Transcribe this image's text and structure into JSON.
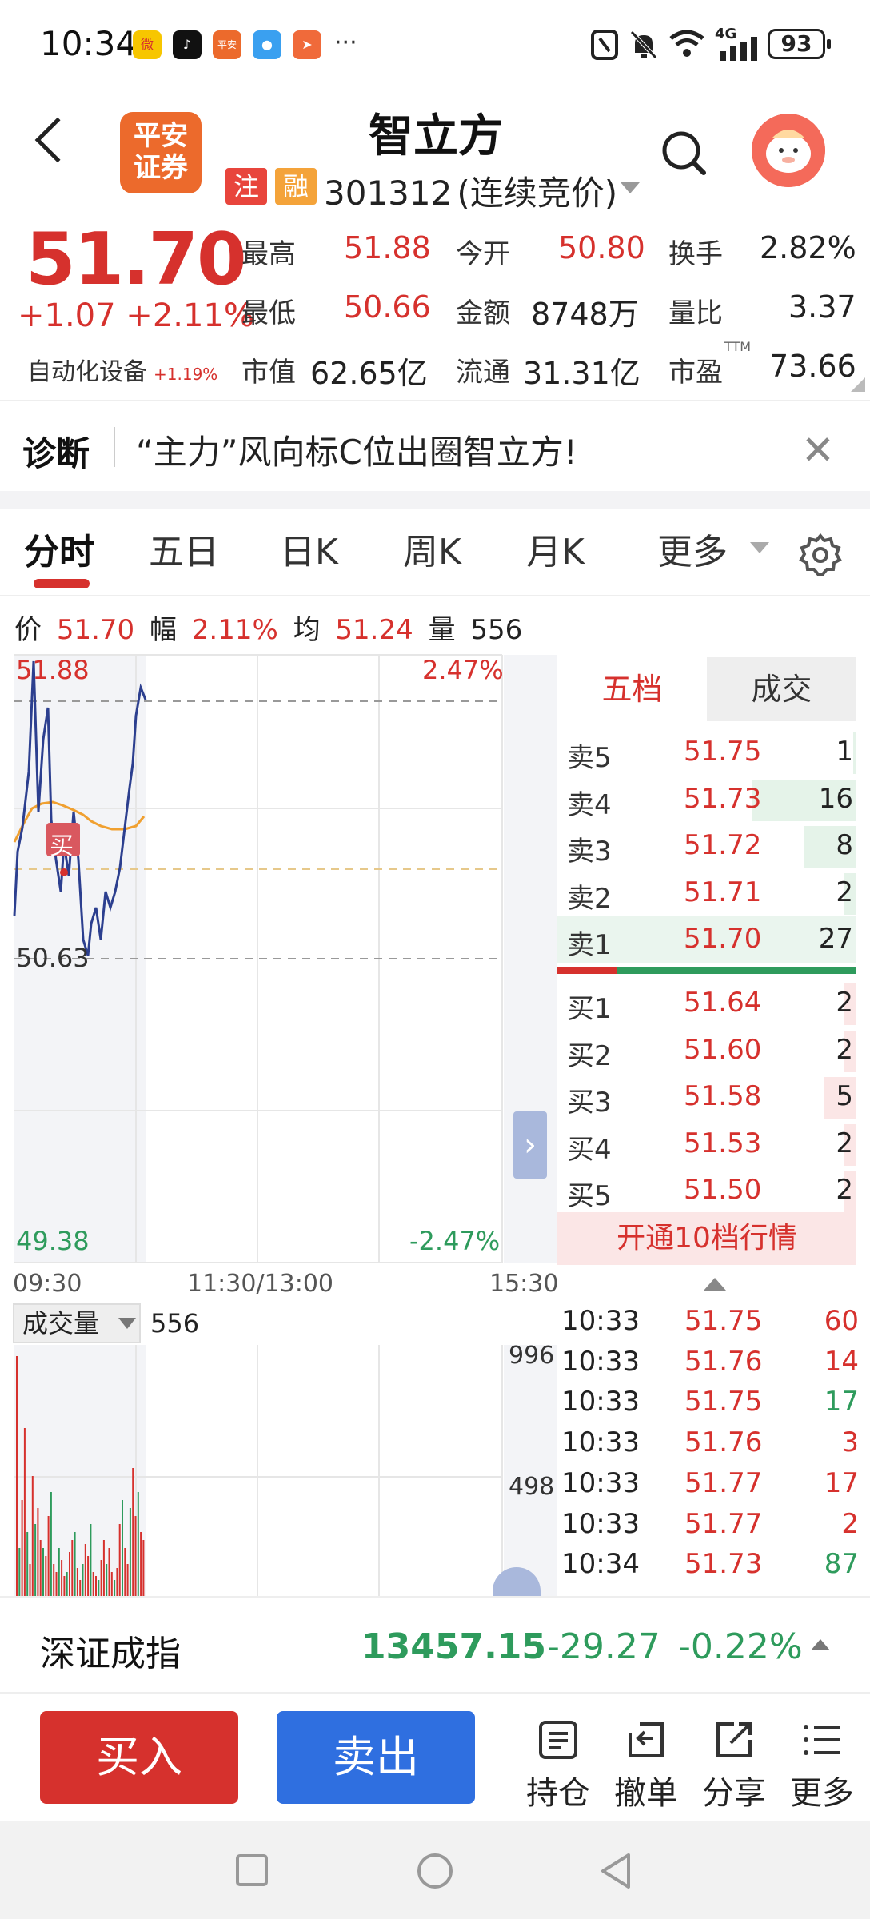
{
  "status_bar": {
    "time": "10:34",
    "battery": "93",
    "network": "4G",
    "icons": [
      "weibo-icon",
      "tiktok-icon",
      "pingan-app-icon",
      "message-icon",
      "send-icon",
      "nfc-icon",
      "mute-icon",
      "wifi-icon",
      "signal-icon"
    ]
  },
  "header": {
    "stock_name": "智立方",
    "badge_1": "注",
    "badge_2": "融",
    "code": "301312",
    "session": "(连续竞价)",
    "broker_logo": "平安证券",
    "colors": {
      "badge_1": "#e8453c",
      "badge_2": "#f4a33a",
      "logo": "#ec6a2c"
    }
  },
  "quote": {
    "price": "51.70",
    "change": "+1.07",
    "change_pct": "+2.11%",
    "sector": "自动化设备",
    "sector_pct": "+1.19%",
    "high_label": "最高",
    "high": "51.88",
    "open_label": "今开",
    "open": "50.80",
    "turnover_label": "换手",
    "turnover": "2.82%",
    "low_label": "最低",
    "low": "50.66",
    "amount_label": "金额",
    "amount": "8748万",
    "vol_ratio_label": "量比",
    "vol_ratio": "3.37",
    "mktcap_label": "市值",
    "mktcap": "62.65亿",
    "float_label": "流通",
    "float_cap": "31.31亿",
    "pe_label": "市盈",
    "pe_ttm_sup": "TTM",
    "pe": "73.66"
  },
  "diagnosis": {
    "title": "诊断",
    "text": "“主力”风向标C位出圈智立方!"
  },
  "tabs": [
    "分时",
    "五日",
    "日K",
    "周K",
    "月K",
    "更多"
  ],
  "intraday_info": {
    "price_label": "价",
    "price": "51.70",
    "amp_label": "幅",
    "amp": "2.11%",
    "avg_label": "均",
    "avg": "51.24",
    "vol_label": "量",
    "vol": "556"
  },
  "chart": {
    "top_price": "51.88",
    "top_pct": "2.47%",
    "mid_price": "50.63",
    "bottom_price": "49.38",
    "bottom_pct": "-2.47%",
    "buy_marker": "买",
    "times": [
      "09:30",
      "11:30/13:00",
      "15:30"
    ]
  },
  "orderbook": {
    "tab_1": "五档",
    "tab_2": "成交",
    "asks": [
      {
        "label": "卖5",
        "price": "51.75",
        "vol": "1",
        "fill": 0.02
      },
      {
        "label": "卖4",
        "price": "51.73",
        "vol": "16",
        "fill": 0.6
      },
      {
        "label": "卖3",
        "price": "51.72",
        "vol": "8",
        "fill": 0.3
      },
      {
        "label": "卖2",
        "price": "51.71",
        "vol": "2",
        "fill": 0.07
      },
      {
        "label": "卖1",
        "price": "51.70",
        "vol": "27",
        "fill": 1.0
      }
    ],
    "bids": [
      {
        "label": "买1",
        "price": "51.64",
        "vol": "2",
        "fill": 0.07
      },
      {
        "label": "买2",
        "price": "51.60",
        "vol": "2",
        "fill": 0.07
      },
      {
        "label": "买3",
        "price": "51.58",
        "vol": "5",
        "fill": 0.19
      },
      {
        "label": "买4",
        "price": "51.53",
        "vol": "2",
        "fill": 0.07
      },
      {
        "label": "买5",
        "price": "51.50",
        "vol": "2",
        "fill": 0.07
      }
    ],
    "open10": "开通10档行情"
  },
  "volume_panel": {
    "label": "成交量",
    "current": "556",
    "axis_top": "996",
    "axis_mid": "498"
  },
  "ticks": [
    {
      "time": "10:33",
      "price": "51.75",
      "vol": "60",
      "color": "#d6312d"
    },
    {
      "time": "10:33",
      "price": "51.76",
      "vol": "14",
      "color": "#d6312d"
    },
    {
      "time": "10:33",
      "price": "51.75",
      "vol": "17",
      "color": "#2e9b5c"
    },
    {
      "time": "10:33",
      "price": "51.76",
      "vol": "3",
      "color": "#d6312d"
    },
    {
      "time": "10:33",
      "price": "51.77",
      "vol": "17",
      "color": "#d6312d"
    },
    {
      "time": "10:33",
      "price": "51.77",
      "vol": "2",
      "color": "#d6312d"
    },
    {
      "time": "10:34",
      "price": "51.73",
      "vol": "87",
      "color": "#2e9b5c"
    }
  ],
  "index_bar": {
    "name": "深证成指",
    "value": "13457.15",
    "change": "-29.27",
    "change_pct": "-0.22%"
  },
  "actions": {
    "buy": "买入",
    "sell": "卖出",
    "holdings": "持仓",
    "cancel": "撤单",
    "share": "分享",
    "more": "更多"
  },
  "colors": {
    "up": "#d6312d",
    "down": "#2e9b5c",
    "price_line": "#2c3f8f",
    "avg_line": "#f0a030",
    "buy": "#d6312d",
    "sell": "#2f6fe0"
  }
}
